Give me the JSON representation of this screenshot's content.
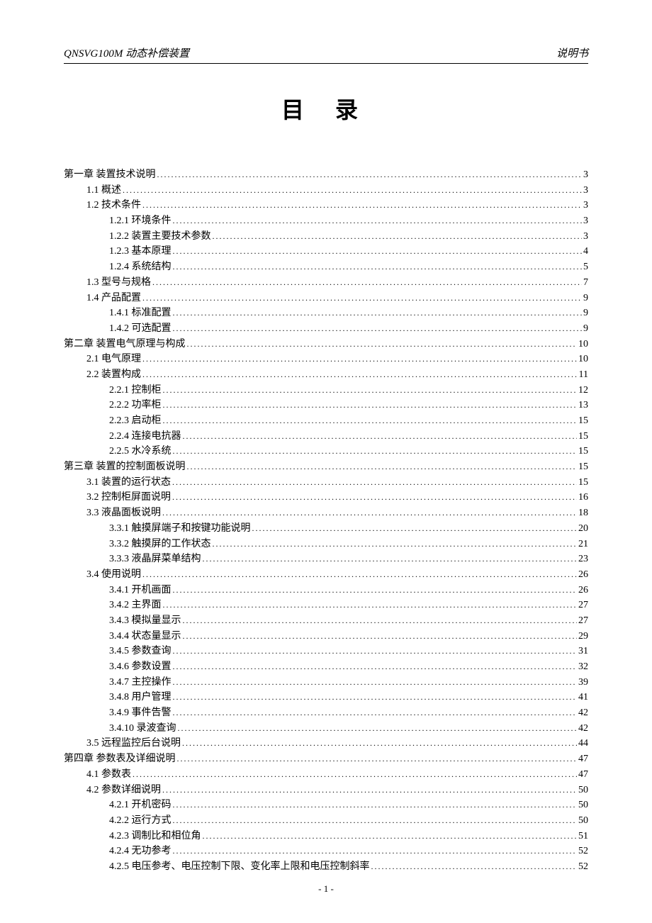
{
  "header": {
    "left": "QNSVG100M 动态补偿装置",
    "right": "说明书"
  },
  "title": "目 录",
  "footer": "- 1 -",
  "toc": [
    {
      "label": "第一章  装置技术说明",
      "page": "3",
      "level": 0
    },
    {
      "label": "1.1 概述",
      "page": "3",
      "level": 1
    },
    {
      "label": "1.2 技术条件",
      "page": "3",
      "level": 1
    },
    {
      "label": "1.2.1  环境条件",
      "page": "3",
      "level": 2
    },
    {
      "label": "1.2.2  装置主要技术参数",
      "page": "3",
      "level": 2
    },
    {
      "label": "1.2.3  基本原理",
      "page": "4",
      "level": 2
    },
    {
      "label": "1.2.4  系统结构",
      "page": "5",
      "level": 2
    },
    {
      "label": "1.3 型号与规格",
      "page": "7",
      "level": 1
    },
    {
      "label": "1.4  产品配置",
      "page": "9",
      "level": 1
    },
    {
      "label": "1.4.1  标准配置",
      "page": "9",
      "level": 2
    },
    {
      "label": "1.4.2  可选配置",
      "page": "9",
      "level": 2
    },
    {
      "label": "第二章  装置电气原理与构成",
      "page": "10",
      "level": 0
    },
    {
      "label": "2.1 电气原理",
      "page": "10",
      "level": 1
    },
    {
      "label": "2.2 装置构成",
      "page": "11",
      "level": 1
    },
    {
      "label": "2.2.1 控制柜",
      "page": "12",
      "level": 2
    },
    {
      "label": "2.2.2 功率柜",
      "page": "13",
      "level": 2
    },
    {
      "label": "2.2.3 启动柜",
      "page": "15",
      "level": 2
    },
    {
      "label": "2.2.4 连接电抗器",
      "page": "15",
      "level": 2
    },
    {
      "label": "2.2.5 水冷系统",
      "page": "15",
      "level": 2
    },
    {
      "label": "第三章  装置的控制面板说明",
      "page": "15",
      "level": 0
    },
    {
      "label": "3.1  装置的运行状态",
      "page": "15",
      "level": 1
    },
    {
      "label": "3.2  控制柜屏面说明",
      "page": "16",
      "level": 1
    },
    {
      "label": "3.3  液晶面板说明",
      "page": "18",
      "level": 1
    },
    {
      "label": "3.3.1  触摸屏端子和按键功能说明",
      "page": "20",
      "level": 2
    },
    {
      "label": "3.3.2  触摸屏的工作状态",
      "page": "21",
      "level": 2
    },
    {
      "label": "3.3.3  液晶屏菜单结构",
      "page": "23",
      "level": 2
    },
    {
      "label": "3.4 使用说明",
      "page": "26",
      "level": 1
    },
    {
      "label": "3.4.1  开机画面",
      "page": "26",
      "level": 2
    },
    {
      "label": "3.4.2  主界面",
      "page": "27",
      "level": 2
    },
    {
      "label": "3.4.3  模拟量显示",
      "page": "27",
      "level": 2
    },
    {
      "label": "3.4.4  状态量显示",
      "page": "29",
      "level": 2
    },
    {
      "label": "3.4.5  参数查询",
      "page": "31",
      "level": 2
    },
    {
      "label": "3.4.6  参数设置",
      "page": "32",
      "level": 2
    },
    {
      "label": "3.4.7  主控操作",
      "page": "39",
      "level": 2
    },
    {
      "label": "3.4.8  用户管理",
      "page": "41",
      "level": 2
    },
    {
      "label": "3.4.9  事件告警",
      "page": "42",
      "level": 2
    },
    {
      "label": "3.4.10  录波查询",
      "page": "42",
      "level": 2
    },
    {
      "label": "3.5  远程监控后台说明",
      "page": "44",
      "level": 1
    },
    {
      "label": "第四章  参数表及详细说明",
      "page": "47",
      "level": 0
    },
    {
      "label": "4.1  参数表",
      "page": "47",
      "level": 1
    },
    {
      "label": "4.2  参数详细说明",
      "page": "50",
      "level": 1
    },
    {
      "label": "4.2.1  开机密码",
      "page": "50",
      "level": 2
    },
    {
      "label": "4.2.2  运行方式",
      "page": "50",
      "level": 2
    },
    {
      "label": "4.2.3  调制比和相位角",
      "page": "51",
      "level": 2
    },
    {
      "label": "4.2.4  无功参考",
      "page": "52",
      "level": 2
    },
    {
      "label": "4.2.5  电压参考、电压控制下限、变化率上限和电压控制斜率",
      "page": "52",
      "level": 2
    }
  ]
}
